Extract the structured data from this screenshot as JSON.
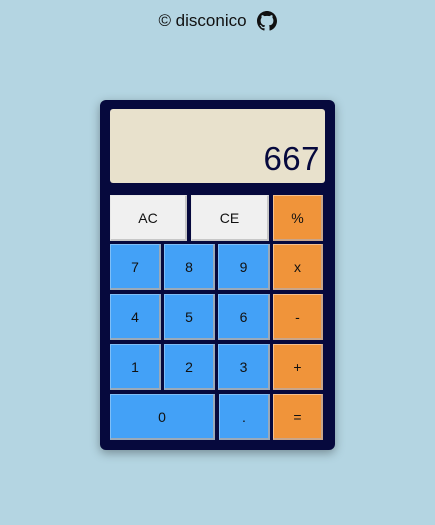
{
  "header": {
    "credit": "© disconico",
    "github_icon": "github-icon"
  },
  "display": {
    "value": "667"
  },
  "buttons": {
    "ac": "AC",
    "ce": "CE",
    "percent": "%",
    "seven": "7",
    "eight": "8",
    "nine": "9",
    "multiply": "x",
    "four": "4",
    "five": "5",
    "six": "6",
    "subtract": "-",
    "one": "1",
    "two": "2",
    "three": "3",
    "add": "+",
    "zero": "0",
    "decimal": ".",
    "equals": "="
  },
  "colors": {
    "background": "#b4d5e2",
    "calculator_body": "#06093d",
    "display": "#e8e1cc",
    "number_button": "#43a1f7",
    "operator_button": "#f0943a",
    "function_button": "#f0f0f0"
  }
}
